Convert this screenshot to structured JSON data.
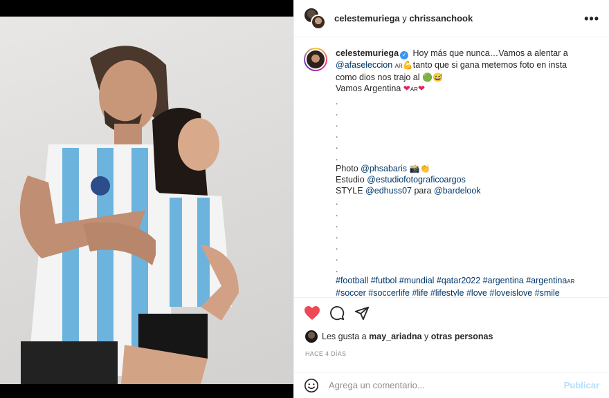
{
  "header": {
    "user1": "celestemuriega",
    "joiner": "y",
    "user2": "chrissanchook",
    "more_label": "•••"
  },
  "caption": {
    "username": "celestemuriega",
    "line1": "Hoy más que nunca…Vamos a alentar a",
    "mention1": "@afaseleccion",
    "flag_ar": "AR",
    "emoji_arm": "💪",
    "line2_rest": "tanto que si gana metemos foto en insta",
    "line3": "como dios nos trajo al",
    "emoji_green": "🟢",
    "emoji_smile": "😅",
    "line4": "Vamos Argentina",
    "emoji_heart": "❤",
    "dots": [
      ".",
      ".",
      ".",
      ".",
      ".",
      "."
    ],
    "photo_label": "Photo",
    "photo_mention": "@phsabaris",
    "photo_emojis": "📸👏",
    "studio_label": "Estudio",
    "studio_mention": "@estudiofotograficoargos",
    "style_label": "STYLE",
    "style_mention": "@edhuss07",
    "style_para": "para",
    "style_mention2": "@bardelook",
    "dots2": [
      ".",
      ".",
      ".",
      ".",
      ".",
      ".",
      "."
    ],
    "hashtags_line1": "#football #futbol #mundial #qatar2022 #argentina #argentina",
    "hashtags_line1_suffix": "AR",
    "hashtags_line2": "#soccer #soccerlife #life #lifestyle #love #loveislove #smile"
  },
  "likes": {
    "prefix": "Les gusta a",
    "user": "may_ariadna",
    "joiner": "y",
    "others": "otras personas"
  },
  "timestamp": "HACE 4 DÍAS",
  "comment": {
    "placeholder": "Agrega un comentario...",
    "publish_label": "Publicar"
  },
  "colors": {
    "like_red": "#ed4956",
    "link_blue": "#00376b",
    "publish_disabled": "#b2dffc"
  }
}
